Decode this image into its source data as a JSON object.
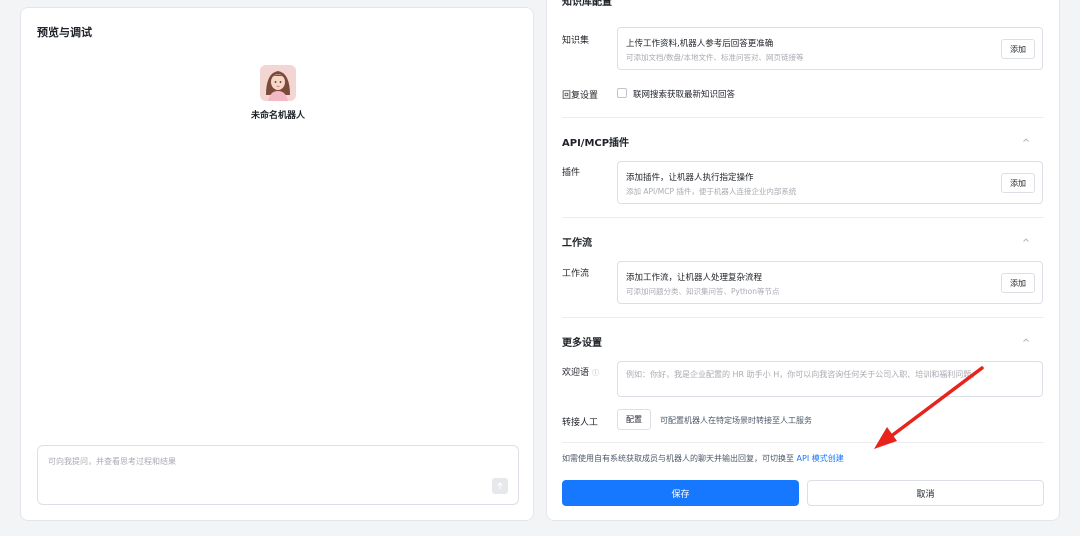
{
  "preview": {
    "title": "预览与调试",
    "bot_name": "未命名机器人",
    "chat_placeholder": "可向我提问，并查看思考过程和结果"
  },
  "knowledge": {
    "section_title": "知识库配置",
    "label": "知识集",
    "card_title": "上传工作资料,机器人参考后回答更准确",
    "card_sub": "可添加文档/数盘/本地文件、标准问答对、网页链接等",
    "add_label": "添加"
  },
  "reply": {
    "label": "回复设置",
    "checkbox_label": "联网搜索获取最新知识回答",
    "checked": false
  },
  "plugins": {
    "section_title": "API/MCP插件",
    "label": "插件",
    "card_title": "添加插件，让机器人执行指定操作",
    "card_sub": "添加 API/MCP 插件，便于机器人连接企业内部系统",
    "add_label": "添加"
  },
  "workflow": {
    "section_title": "工作流",
    "label": "工作流",
    "card_title": "添加工作流，让机器人处理复杂流程",
    "card_sub": "可添加问题分类、知识集问答、Python等节点",
    "add_label": "添加"
  },
  "more": {
    "section_title": "更多设置",
    "welcome_label": "欢迎语",
    "welcome_info_icon": "ⓘ",
    "welcome_placeholder": "例如：你好，我是企业配置的 HR 助手小 H，你可以向我咨询任何关于公司入职、培训和福利问题。",
    "transfer_label": "转接人工",
    "config_label": "配置",
    "config_desc": "可配置机器人在特定场景时转接至人工服务"
  },
  "api_note": {
    "text": "如需使用自有系统获取成员与机器人的聊天并输出回复，可切换至",
    "link": "API 模式创建"
  },
  "footer": {
    "save_label": "保存",
    "cancel_label": "取消"
  },
  "colors": {
    "primary": "#1677ff",
    "annotation_arrow": "#e8231c"
  }
}
